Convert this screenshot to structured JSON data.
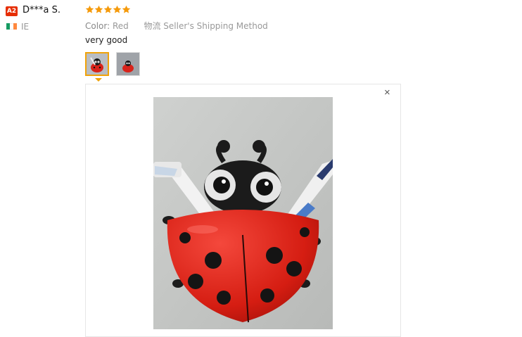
{
  "review": {
    "badge_label": "A2",
    "username": "D***a S.",
    "country_code": "IE",
    "flag_colors": [
      "#169b62",
      "#ffffff",
      "#ff883e"
    ],
    "rating": 5,
    "rating_max": 5,
    "star_color": "#f59a0b",
    "color_label": "Color:",
    "color_value": "Red",
    "shipping_value": "物流 Seller's Shipping Method",
    "feedback_text": "very good"
  },
  "viewer": {
    "close_glyph": "×",
    "thumbnails": [
      {
        "name": "thumbnail-1",
        "active": true
      },
      {
        "name": "thumbnail-2",
        "active": false
      }
    ],
    "active_color": "#f0a30a"
  },
  "icons": {
    "close": "close-icon",
    "star": "star-icon",
    "flag": "ireland-flag-icon"
  }
}
